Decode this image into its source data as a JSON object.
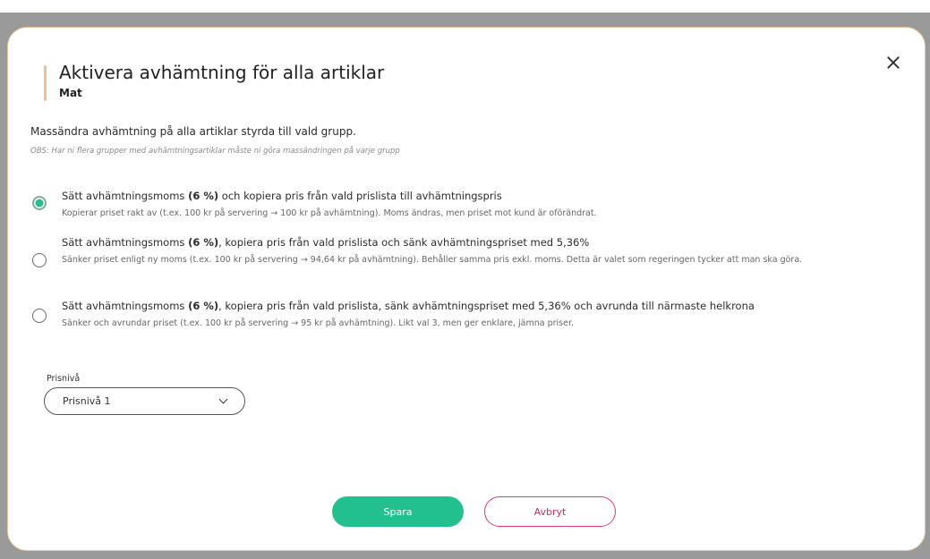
{
  "dialog": {
    "title": "Aktivera avhämtning för alla artiklar",
    "subtitle": "Mat",
    "description": "Massändra avhämtning på alla artiklar styrda till vald grupp.",
    "note": "OBS: Har ni flera grupper med avhämtningsartiklar måste ni göra massändringen på varje grupp"
  },
  "options": [
    {
      "title_pre": "Sätt avhämtningsmoms ",
      "title_bold": "(6 %)",
      "title_post": " och kopiera pris från vald prislista till avhämtningspris",
      "description": "Kopierar priset rakt av (t.ex. 100 kr på servering → 100 kr på avhämtning). Moms ändras, men priset mot kund är oförändrat.",
      "selected": true
    },
    {
      "title_pre": "Sätt avhämtningsmoms ",
      "title_bold": "(6 %)",
      "title_post": ", kopiera pris från vald prislista och sänk avhämtningspriset med 5,36%",
      "description": "Sänker priset enligt ny moms (t.ex. 100 kr på servering → 94,64 kr på avhämtning). Behåller samma pris exkl. moms. Detta är valet som regeringen tycker att man ska göra.",
      "selected": false
    },
    {
      "title_pre": "Sätt avhämtningsmoms ",
      "title_bold": "(6 %)",
      "title_post": ", kopiera pris från vald prislista, sänk avhämtningspriset med 5,36% och avrunda till närmaste helkrona",
      "description": "Sänker och avrundar priset (t.ex. 100 kr på servering → 95 kr på avhämtning). Likt val 3, men ger enklare, jämna priser.",
      "selected": false
    }
  ],
  "price_level": {
    "label": "Prisnivå",
    "value": "Prisnivå 1"
  },
  "buttons": {
    "save": "Spara",
    "cancel": "Avbryt"
  },
  "colors": {
    "accent_green": "#22c08e",
    "cancel_red": "#e23a6a",
    "title_accent": "#f2c08e"
  },
  "icons": {
    "close": "close-icon",
    "dropdown": "chevron-down-icon"
  }
}
